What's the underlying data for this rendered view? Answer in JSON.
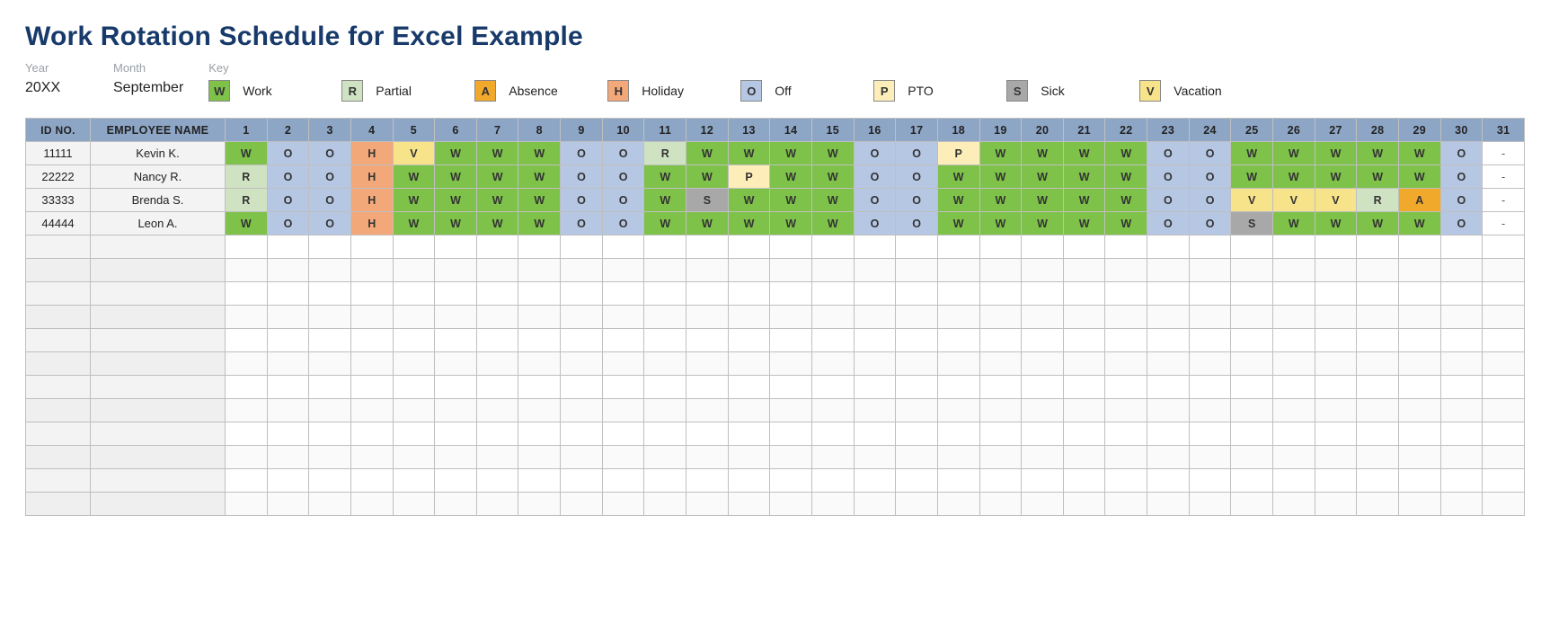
{
  "title": "Work Rotation Schedule for Excel Example",
  "meta": {
    "year_label": "Year",
    "year_value": "20XX",
    "month_label": "Month",
    "month_value": "September",
    "key_label": "Key"
  },
  "legend": [
    {
      "code": "W",
      "label": "Work"
    },
    {
      "code": "R",
      "label": "Partial"
    },
    {
      "code": "A",
      "label": "Absence"
    },
    {
      "code": "H",
      "label": "Holiday"
    },
    {
      "code": "O",
      "label": "Off"
    },
    {
      "code": "P",
      "label": "PTO"
    },
    {
      "code": "S",
      "label": "Sick"
    },
    {
      "code": "V",
      "label": "Vacation"
    }
  ],
  "headers": {
    "id": "ID NO.",
    "name": "EMPLOYEE NAME",
    "days": [
      "1",
      "2",
      "3",
      "4",
      "5",
      "6",
      "7",
      "8",
      "9",
      "10",
      "11",
      "12",
      "13",
      "14",
      "15",
      "16",
      "17",
      "18",
      "19",
      "20",
      "21",
      "22",
      "23",
      "24",
      "25",
      "26",
      "27",
      "28",
      "29",
      "30",
      "31"
    ]
  },
  "rows": [
    {
      "id": "11111",
      "name": "Kevin K.",
      "days": [
        "W",
        "O",
        "O",
        "H",
        "V",
        "W",
        "W",
        "W",
        "O",
        "O",
        "R",
        "W",
        "W",
        "W",
        "W",
        "O",
        "O",
        "P",
        "W",
        "W",
        "W",
        "W",
        "O",
        "O",
        "W",
        "W",
        "W",
        "W",
        "W",
        "O",
        "-"
      ]
    },
    {
      "id": "22222",
      "name": "Nancy R.",
      "days": [
        "R",
        "O",
        "O",
        "H",
        "W",
        "W",
        "W",
        "W",
        "O",
        "O",
        "W",
        "W",
        "P",
        "W",
        "W",
        "O",
        "O",
        "W",
        "W",
        "W",
        "W",
        "W",
        "O",
        "O",
        "W",
        "W",
        "W",
        "W",
        "W",
        "O",
        "-"
      ]
    },
    {
      "id": "33333",
      "name": "Brenda S.",
      "days": [
        "R",
        "O",
        "O",
        "H",
        "W",
        "W",
        "W",
        "W",
        "O",
        "O",
        "W",
        "S",
        "W",
        "W",
        "W",
        "O",
        "O",
        "W",
        "W",
        "W",
        "W",
        "W",
        "O",
        "O",
        "V",
        "V",
        "V",
        "R",
        "A",
        "O",
        "-"
      ]
    },
    {
      "id": "44444",
      "name": "Leon A.",
      "days": [
        "W",
        "O",
        "O",
        "H",
        "W",
        "W",
        "W",
        "W",
        "O",
        "O",
        "W",
        "W",
        "W",
        "W",
        "W",
        "O",
        "O",
        "W",
        "W",
        "W",
        "W",
        "W",
        "O",
        "O",
        "S",
        "W",
        "W",
        "W",
        "W",
        "O",
        "-"
      ]
    }
  ],
  "empty_rows": 12
}
